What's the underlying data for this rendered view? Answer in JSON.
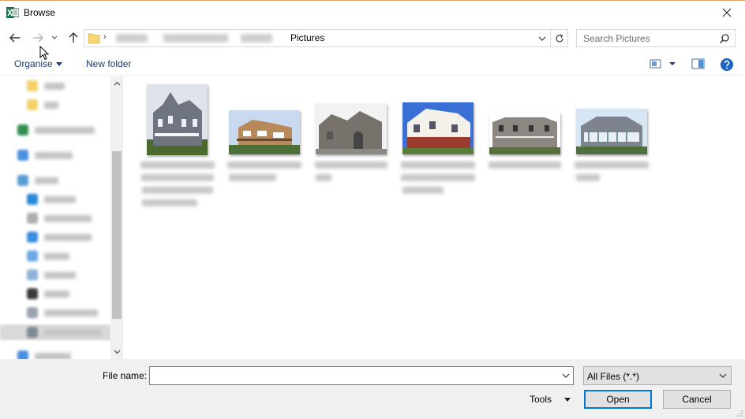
{
  "window": {
    "title": "Browse",
    "app_icon": "excel-icon"
  },
  "address": {
    "current": "Pictures"
  },
  "search": {
    "placeholder": "Search Pictures"
  },
  "toolbar": {
    "organise_label": "Organise",
    "new_folder_label": "New folder"
  },
  "files": [
    {
      "thumb_colors": [
        "#dfe4ea",
        "#6e7580",
        "#4d6a2e"
      ]
    },
    {
      "thumb_colors": [
        "#c9d9ef",
        "#b88a5a",
        "#4d6e38"
      ]
    },
    {
      "thumb_colors": [
        "#f2f2f2",
        "#77736c",
        "#8a8a82"
      ]
    },
    {
      "thumb_colors": [
        "#3a6fd6",
        "#f4f1ea",
        "#9a3d2e"
      ]
    },
    {
      "thumb_colors": [
        "#ffffff",
        "#8c8780",
        "#557038"
      ]
    },
    {
      "thumb_colors": [
        "#d6e6f5",
        "#7d8490",
        "#4f6f3f"
      ]
    }
  ],
  "bottom": {
    "file_name_label": "File name:",
    "file_name_value": "",
    "file_type_selected": "All Files (*.*)",
    "tools_label": "Tools",
    "open_label": "Open",
    "cancel_label": "Cancel"
  },
  "colors": {
    "accent": "#0078d7",
    "link_text": "#1e3c78",
    "title_accent_line": "#e8a060"
  }
}
